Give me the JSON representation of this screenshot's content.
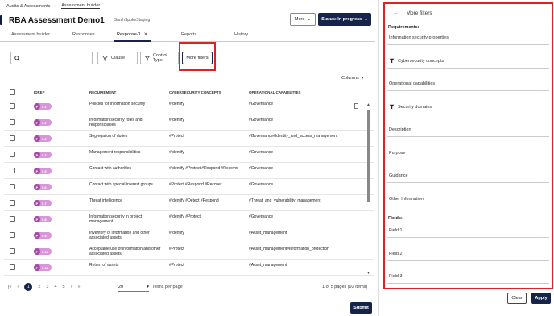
{
  "breadcrumb": [
    "Audits & Assessments",
    "Assessment builder"
  ],
  "title": "RBA Assessment Demo1",
  "subtitle": "SarahSpokeStaging",
  "header": {
    "more_label": "More",
    "status_label": "Status: In progress"
  },
  "tabs": [
    {
      "label": "Assessment builder"
    },
    {
      "label": "Responses"
    },
    {
      "label": "Response-1"
    },
    {
      "label": "Reports"
    },
    {
      "label": "History"
    }
  ],
  "filters": {
    "search_placeholder": "",
    "clause_label": "Clause",
    "control_type_label": "Control Type",
    "more_filters_label": "More filters"
  },
  "columns_label": "Columns",
  "table": {
    "headers": [
      "IDREF",
      "REQUIREMENT",
      "CYBERSECURITY CONCEPTS",
      "OPERATIONAL CAPABILITIES"
    ],
    "rows": [
      {
        "id": "5.1",
        "req": "Policies for information security",
        "cyber": "#Identify",
        "op": "#Governance"
      },
      {
        "id": "5.2",
        "req": "Information security roles and responsibilities",
        "cyber": "#Identify",
        "op": "#Governance"
      },
      {
        "id": "5.3",
        "req": "Segregation of duties",
        "cyber": "#Protect",
        "op": "#Governance#Identity_and_access_management"
      },
      {
        "id": "5.4",
        "req": "Management responsibilities",
        "cyber": "#Identify",
        "op": "#Governance"
      },
      {
        "id": "5.5",
        "req": "Contact with authorities",
        "cyber": "#Identify #Protect #Respond #Recover",
        "op": "#Governance"
      },
      {
        "id": "5.6",
        "req": "Contact with special interest groups",
        "cyber": "#Protect #Respond #Recover",
        "op": "#Governance"
      },
      {
        "id": "5.7",
        "req": "Threat intelligence",
        "cyber": "#Identify #Detect #Respond",
        "op": "#Threat_and_vulnerability_management"
      },
      {
        "id": "5.8",
        "req": "Information security in project management",
        "cyber": "#Identify #Protect",
        "op": "#Governance"
      },
      {
        "id": "5.9",
        "req": "Inventory of information and other associated assets",
        "cyber": "#Identify",
        "op": "#Asset_management"
      },
      {
        "id": "5.10",
        "req": "Acceptable use of information and other associated assets",
        "cyber": "#Protect",
        "op": "#Asset_management#Information_protection"
      },
      {
        "id": "5.11",
        "req": "Return of assets",
        "cyber": "#Protect",
        "op": "#Asset_management"
      }
    ]
  },
  "pagination": {
    "pages": [
      "1",
      "2",
      "3",
      "4",
      "5"
    ],
    "per_page": "20",
    "per_page_label": "Items per page",
    "info": "1 of 5 pages (93 items)"
  },
  "submit_label": "Submit",
  "panel": {
    "title": "More filters",
    "requirements_label": "Requirements:",
    "fields_top": [
      {
        "label": "Information security properties",
        "filter": false
      },
      {
        "label": "Cybersecurity concepts",
        "filter": true
      },
      {
        "label": "Operational capabilities",
        "filter": false
      },
      {
        "label": "Security domains",
        "filter": true
      },
      {
        "label": "Description",
        "filter": false
      },
      {
        "label": "Purpose",
        "filter": false
      },
      {
        "label": "Guidance",
        "filter": false
      },
      {
        "label": "Other Information",
        "filter": false
      }
    ],
    "fields_label": "Fields:",
    "fields_bottom": [
      {
        "label": "Field 1"
      },
      {
        "label": "Field 2"
      },
      {
        "label": "Field 3"
      }
    ],
    "clear_label": "Clear",
    "apply_label": "Apply"
  },
  "colors": {
    "primary": "#16244a",
    "pill": "#d896d8",
    "highlight": "#dd2222"
  }
}
